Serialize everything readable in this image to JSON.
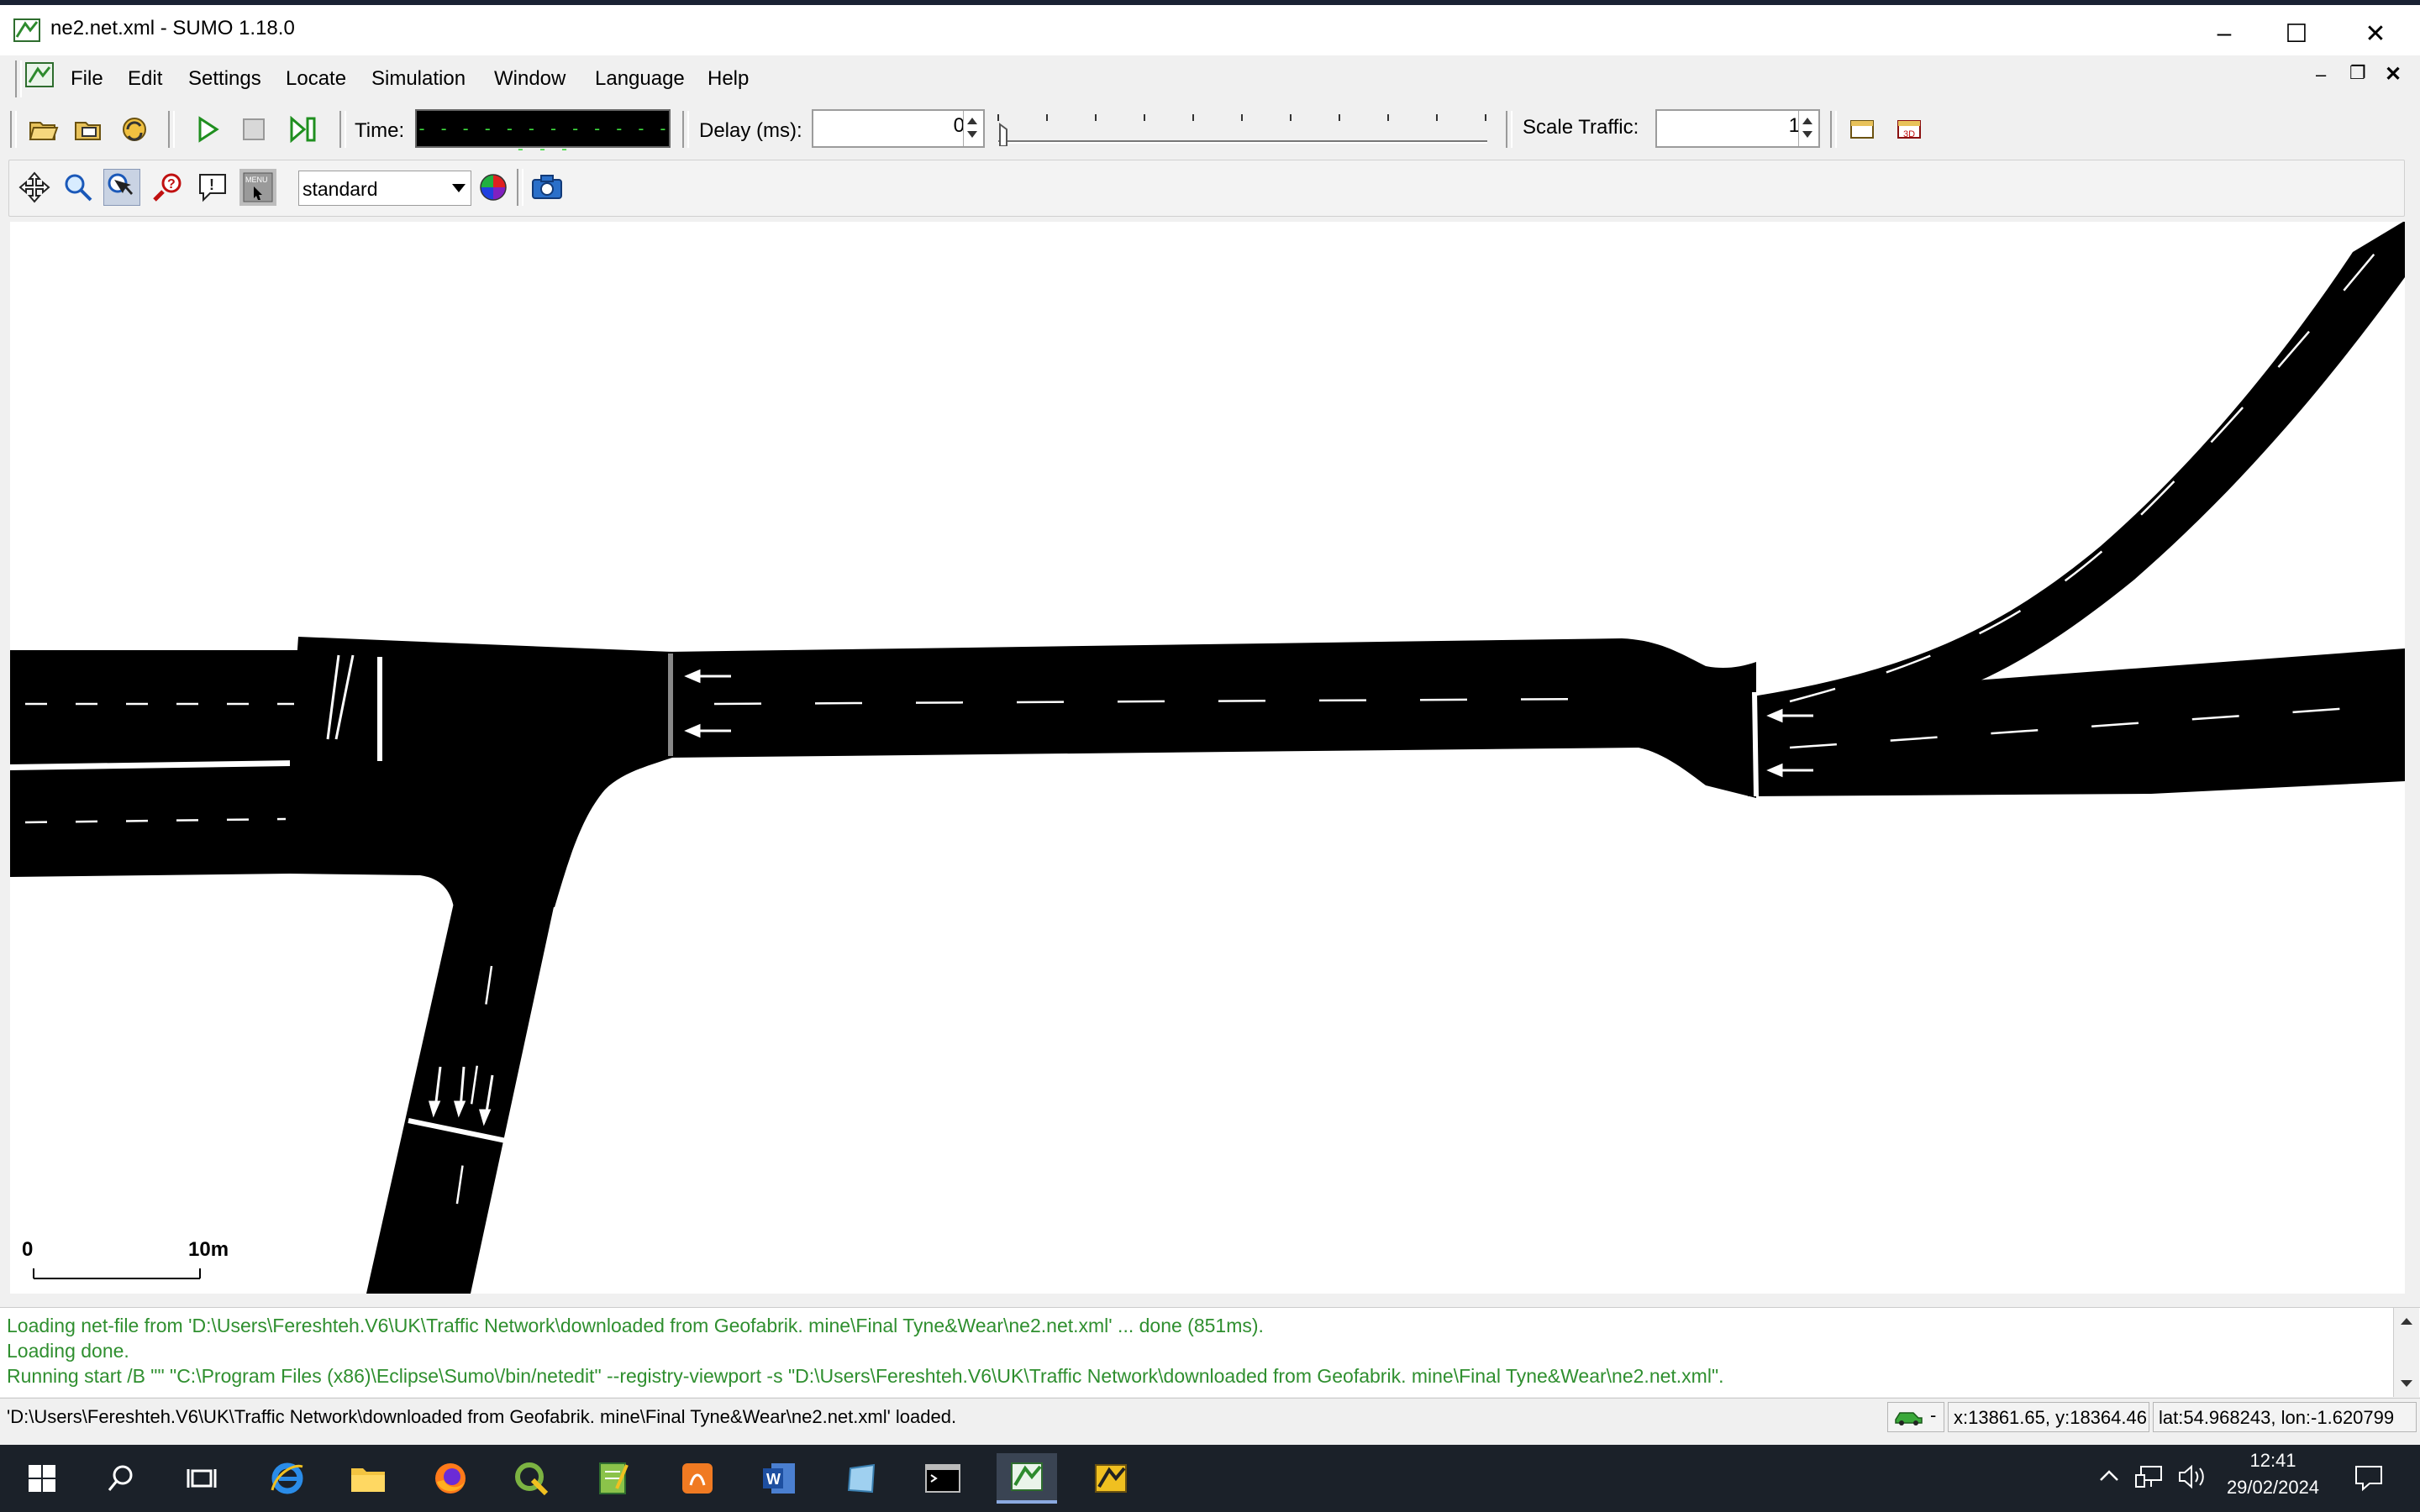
{
  "window": {
    "title": "ne2.net.xml - SUMO 1.18.0",
    "minimize": "–",
    "maximize": "☐",
    "close": "✕"
  },
  "menu": {
    "items": [
      {
        "label": "File"
      },
      {
        "label": "Edit"
      },
      {
        "label": "Settings"
      },
      {
        "label": "Locate"
      },
      {
        "label": "Simulation"
      },
      {
        "label": "Window"
      },
      {
        "label": "Language"
      },
      {
        "label": "Help"
      }
    ],
    "mdi_minimize": "–",
    "mdi_restore": "❐",
    "mdi_close": "✕"
  },
  "toolbar": {
    "time_label": "Time:",
    "time_display": "- - - - - - - - - - - - - - -",
    "delay_label": "Delay (ms):",
    "delay_value": "0",
    "scale_label": "Scale Traffic:",
    "scale_value": "1"
  },
  "view_toolbar": {
    "scheme_value": "standard"
  },
  "scale_bar": {
    "start": "0",
    "end": "10m"
  },
  "log": [
    "Loading net-file from 'D:\\Users\\Fereshteh.V6\\UK\\Traffic Network\\downloaded from Geofabrik. mine\\Final Tyne&Wear\\ne2.net.xml' ... done (851ms).",
    "Loading done.",
    "Running start /B \"\" \"C:\\Program Files (x86)\\Eclipse\\Sumo\\/bin/netedit\" --registry-viewport -s \"D:\\Users\\Fereshteh.V6\\UK\\Traffic Network\\downloaded from Geofabrik. mine\\Final Tyne&Wear\\ne2.net.xml\"."
  ],
  "status": {
    "message": "'D:\\Users\\Fereshteh.V6\\UK\\Traffic Network\\downloaded from Geofabrik. mine\\Final Tyne&Wear\\ne2.net.xml' loaded.",
    "vehicle_indicator": "-",
    "xy": "x:13861.65, y:18364.46",
    "latlon": "lat:54.968243, lon:-1.620799"
  },
  "taskbar": {
    "time": "12:41",
    "date": "29/02/2024"
  },
  "colors": {
    "log_green": "#2f8f2f",
    "road": "#000000",
    "taskbar": "#1b2129"
  }
}
